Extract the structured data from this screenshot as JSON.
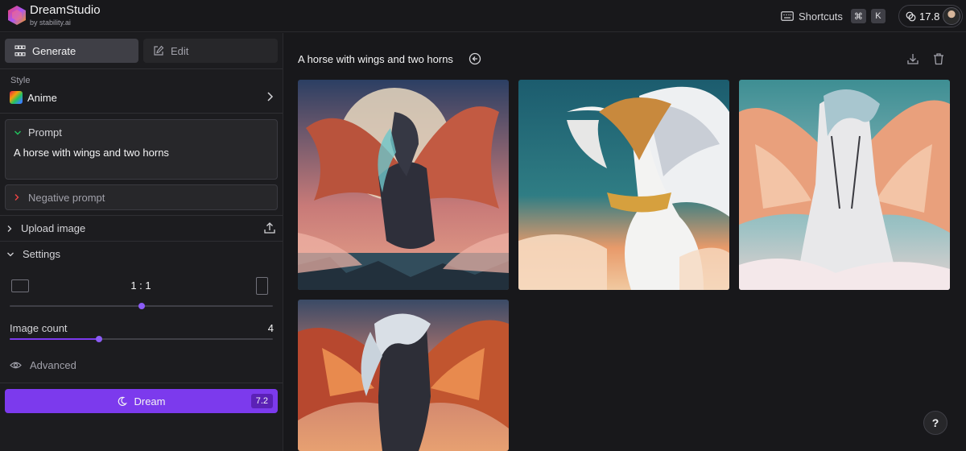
{
  "app": {
    "name": "DreamStudio",
    "subtitle": "by stability.ai"
  },
  "topbar": {
    "shortcuts_label": "Shortcuts",
    "shortcut_keys": [
      "⌘",
      "K"
    ],
    "credits": "17.8"
  },
  "tabs": [
    {
      "label": "Generate",
      "icon": "grid-icon",
      "active": true
    },
    {
      "label": "Edit",
      "icon": "edit-icon",
      "active": false
    }
  ],
  "style": {
    "label": "Style",
    "value": "Anime"
  },
  "prompt": {
    "label": "Prompt",
    "value": "A horse with wings and two horns"
  },
  "negative_prompt": {
    "label": "Negative prompt"
  },
  "upload": {
    "label": "Upload image"
  },
  "settings": {
    "label": "Settings",
    "aspect_ratio": "1 : 1",
    "aspect_slider_fraction": 0.5,
    "image_count_label": "Image count",
    "image_count": "4",
    "image_count_slider_fraction": 0.34,
    "advanced_label": "Advanced"
  },
  "dream": {
    "label": "Dream",
    "cost": "7.2"
  },
  "gallery": {
    "title": "A horse with wings and two horns",
    "images": [
      {
        "subject": "dark-pegasus-moon"
      },
      {
        "subject": "white-unicorn-pegasus-gold"
      },
      {
        "subject": "white-pegasus-clouds"
      },
      {
        "subject": "dark-pegasus-fiery-wings"
      }
    ]
  },
  "help": {
    "label": "?"
  },
  "colors": {
    "accent": "#7c3aed",
    "background": "#18181b",
    "panel": "#27272a"
  }
}
